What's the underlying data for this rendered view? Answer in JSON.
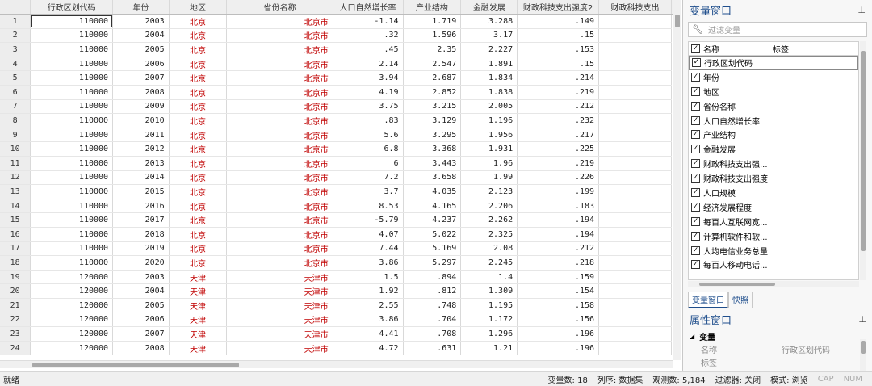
{
  "grid": {
    "columns": [
      "行政区划代码",
      "年份",
      "地区",
      "省份名称",
      "人口自然增长率",
      "产业结构",
      "金融发展",
      "财政科技支出强度2",
      "财政科技支出"
    ],
    "rows": [
      [
        "1",
        "110000",
        "2003",
        "北京",
        "北京市",
        "-1.14",
        "1.719",
        "3.288",
        ".149"
      ],
      [
        "2",
        "110000",
        "2004",
        "北京",
        "北京市",
        ".32",
        "1.596",
        "3.17",
        ".15"
      ],
      [
        "3",
        "110000",
        "2005",
        "北京",
        "北京市",
        ".45",
        "2.35",
        "2.227",
        ".153"
      ],
      [
        "4",
        "110000",
        "2006",
        "北京",
        "北京市",
        "2.14",
        "2.547",
        "1.891",
        ".15"
      ],
      [
        "5",
        "110000",
        "2007",
        "北京",
        "北京市",
        "3.94",
        "2.687",
        "1.834",
        ".214"
      ],
      [
        "6",
        "110000",
        "2008",
        "北京",
        "北京市",
        "4.19",
        "2.852",
        "1.838",
        ".219"
      ],
      [
        "7",
        "110000",
        "2009",
        "北京",
        "北京市",
        "3.75",
        "3.215",
        "2.005",
        ".212"
      ],
      [
        "8",
        "110000",
        "2010",
        "北京",
        "北京市",
        ".83",
        "3.129",
        "1.196",
        ".232"
      ],
      [
        "9",
        "110000",
        "2011",
        "北京",
        "北京市",
        "5.6",
        "3.295",
        "1.956",
        ".217"
      ],
      [
        "10",
        "110000",
        "2012",
        "北京",
        "北京市",
        "6.8",
        "3.368",
        "1.931",
        ".225"
      ],
      [
        "11",
        "110000",
        "2013",
        "北京",
        "北京市",
        "6",
        "3.443",
        "1.96",
        ".219"
      ],
      [
        "12",
        "110000",
        "2014",
        "北京",
        "北京市",
        "7.2",
        "3.658",
        "1.99",
        ".226"
      ],
      [
        "13",
        "110000",
        "2015",
        "北京",
        "北京市",
        "3.7",
        "4.035",
        "2.123",
        ".199"
      ],
      [
        "14",
        "110000",
        "2016",
        "北京",
        "北京市",
        "8.53",
        "4.165",
        "2.206",
        ".183"
      ],
      [
        "15",
        "110000",
        "2017",
        "北京",
        "北京市",
        "-5.79",
        "4.237",
        "2.262",
        ".194"
      ],
      [
        "16",
        "110000",
        "2018",
        "北京",
        "北京市",
        "4.07",
        "5.022",
        "2.325",
        ".194"
      ],
      [
        "17",
        "110000",
        "2019",
        "北京",
        "北京市",
        "7.44",
        "5.169",
        "2.08",
        ".212"
      ],
      [
        "18",
        "110000",
        "2020",
        "北京",
        "北京市",
        "3.86",
        "5.297",
        "2.245",
        ".218"
      ],
      [
        "19",
        "120000",
        "2003",
        "天津",
        "天津市",
        "1.5",
        ".894",
        "1.4",
        ".159"
      ],
      [
        "20",
        "120000",
        "2004",
        "天津",
        "天津市",
        "1.92",
        ".812",
        "1.309",
        ".154"
      ],
      [
        "21",
        "120000",
        "2005",
        "天津",
        "天津市",
        "2.55",
        ".748",
        "1.195",
        ".158"
      ],
      [
        "22",
        "120000",
        "2006",
        "天津",
        "天津市",
        "3.86",
        ".704",
        "1.172",
        ".156"
      ],
      [
        "23",
        "120000",
        "2007",
        "天津",
        "天津市",
        "4.41",
        ".708",
        "1.296",
        ".196"
      ],
      [
        "24",
        "120000",
        "2008",
        "天津",
        "天津市",
        "4.72",
        ".631",
        "1.21",
        ".196"
      ]
    ]
  },
  "varwin": {
    "title": "变量窗口",
    "pin": "⊥",
    "filter_placeholder": "过滤变量",
    "head_name": "名称",
    "head_label": "标签",
    "items": [
      "行政区划代码",
      "年份",
      "地区",
      "省份名称",
      "人口自然增长率",
      "产业结构",
      "金融发展",
      "财政科技支出强...",
      "财政科技支出强度",
      "人口规模",
      "经济发展程度",
      "每百人互联网宽...",
      "计算机软件和软...",
      "人均电信业务总量",
      "每百人移动电话..."
    ],
    "tabs": [
      "变量窗口",
      "快照"
    ]
  },
  "propwin": {
    "title": "属性窗口",
    "pin": "⊥",
    "group": "变量",
    "rows": [
      {
        "k": "名称",
        "v": "行政区划代码"
      },
      {
        "k": "标签",
        "v": ""
      }
    ]
  },
  "status": {
    "left": "就绪",
    "vars": "变量数: 18",
    "order": "列序: 数据集",
    "obs": "观测数: 5,184",
    "filter": "过滤器: 关闭",
    "mode": "模式: 浏览",
    "cap": "CAP",
    "num": "NUM"
  },
  "colors": {
    "string_red": "#c00000",
    "accent": "#1f4e8c"
  }
}
